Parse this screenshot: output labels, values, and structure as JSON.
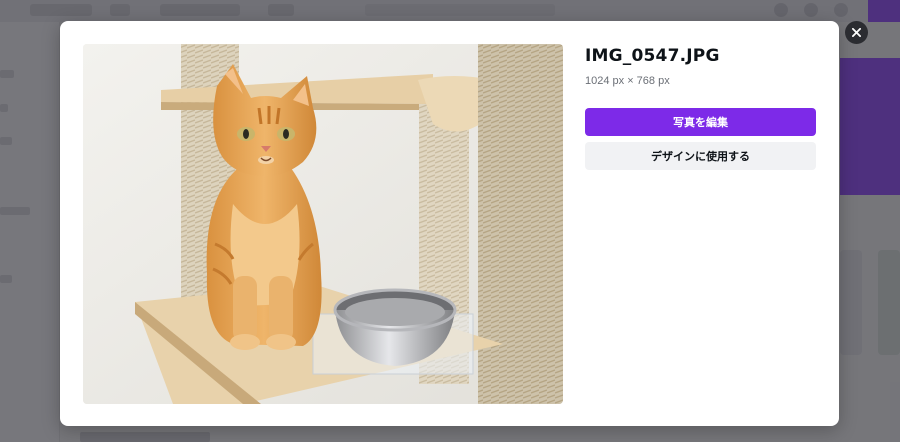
{
  "image_preview": {
    "filename": "IMG_0547.JPG",
    "dimensions": "1024 px × 768 px",
    "primary_button_label": "写真を編集",
    "secondary_button_label": "デザインに使用する",
    "close_icon": "close-icon"
  },
  "colors": {
    "primary": "#7d2ae8",
    "secondary_bg": "#f1f2f4",
    "close_bg": "#2b2c31"
  }
}
